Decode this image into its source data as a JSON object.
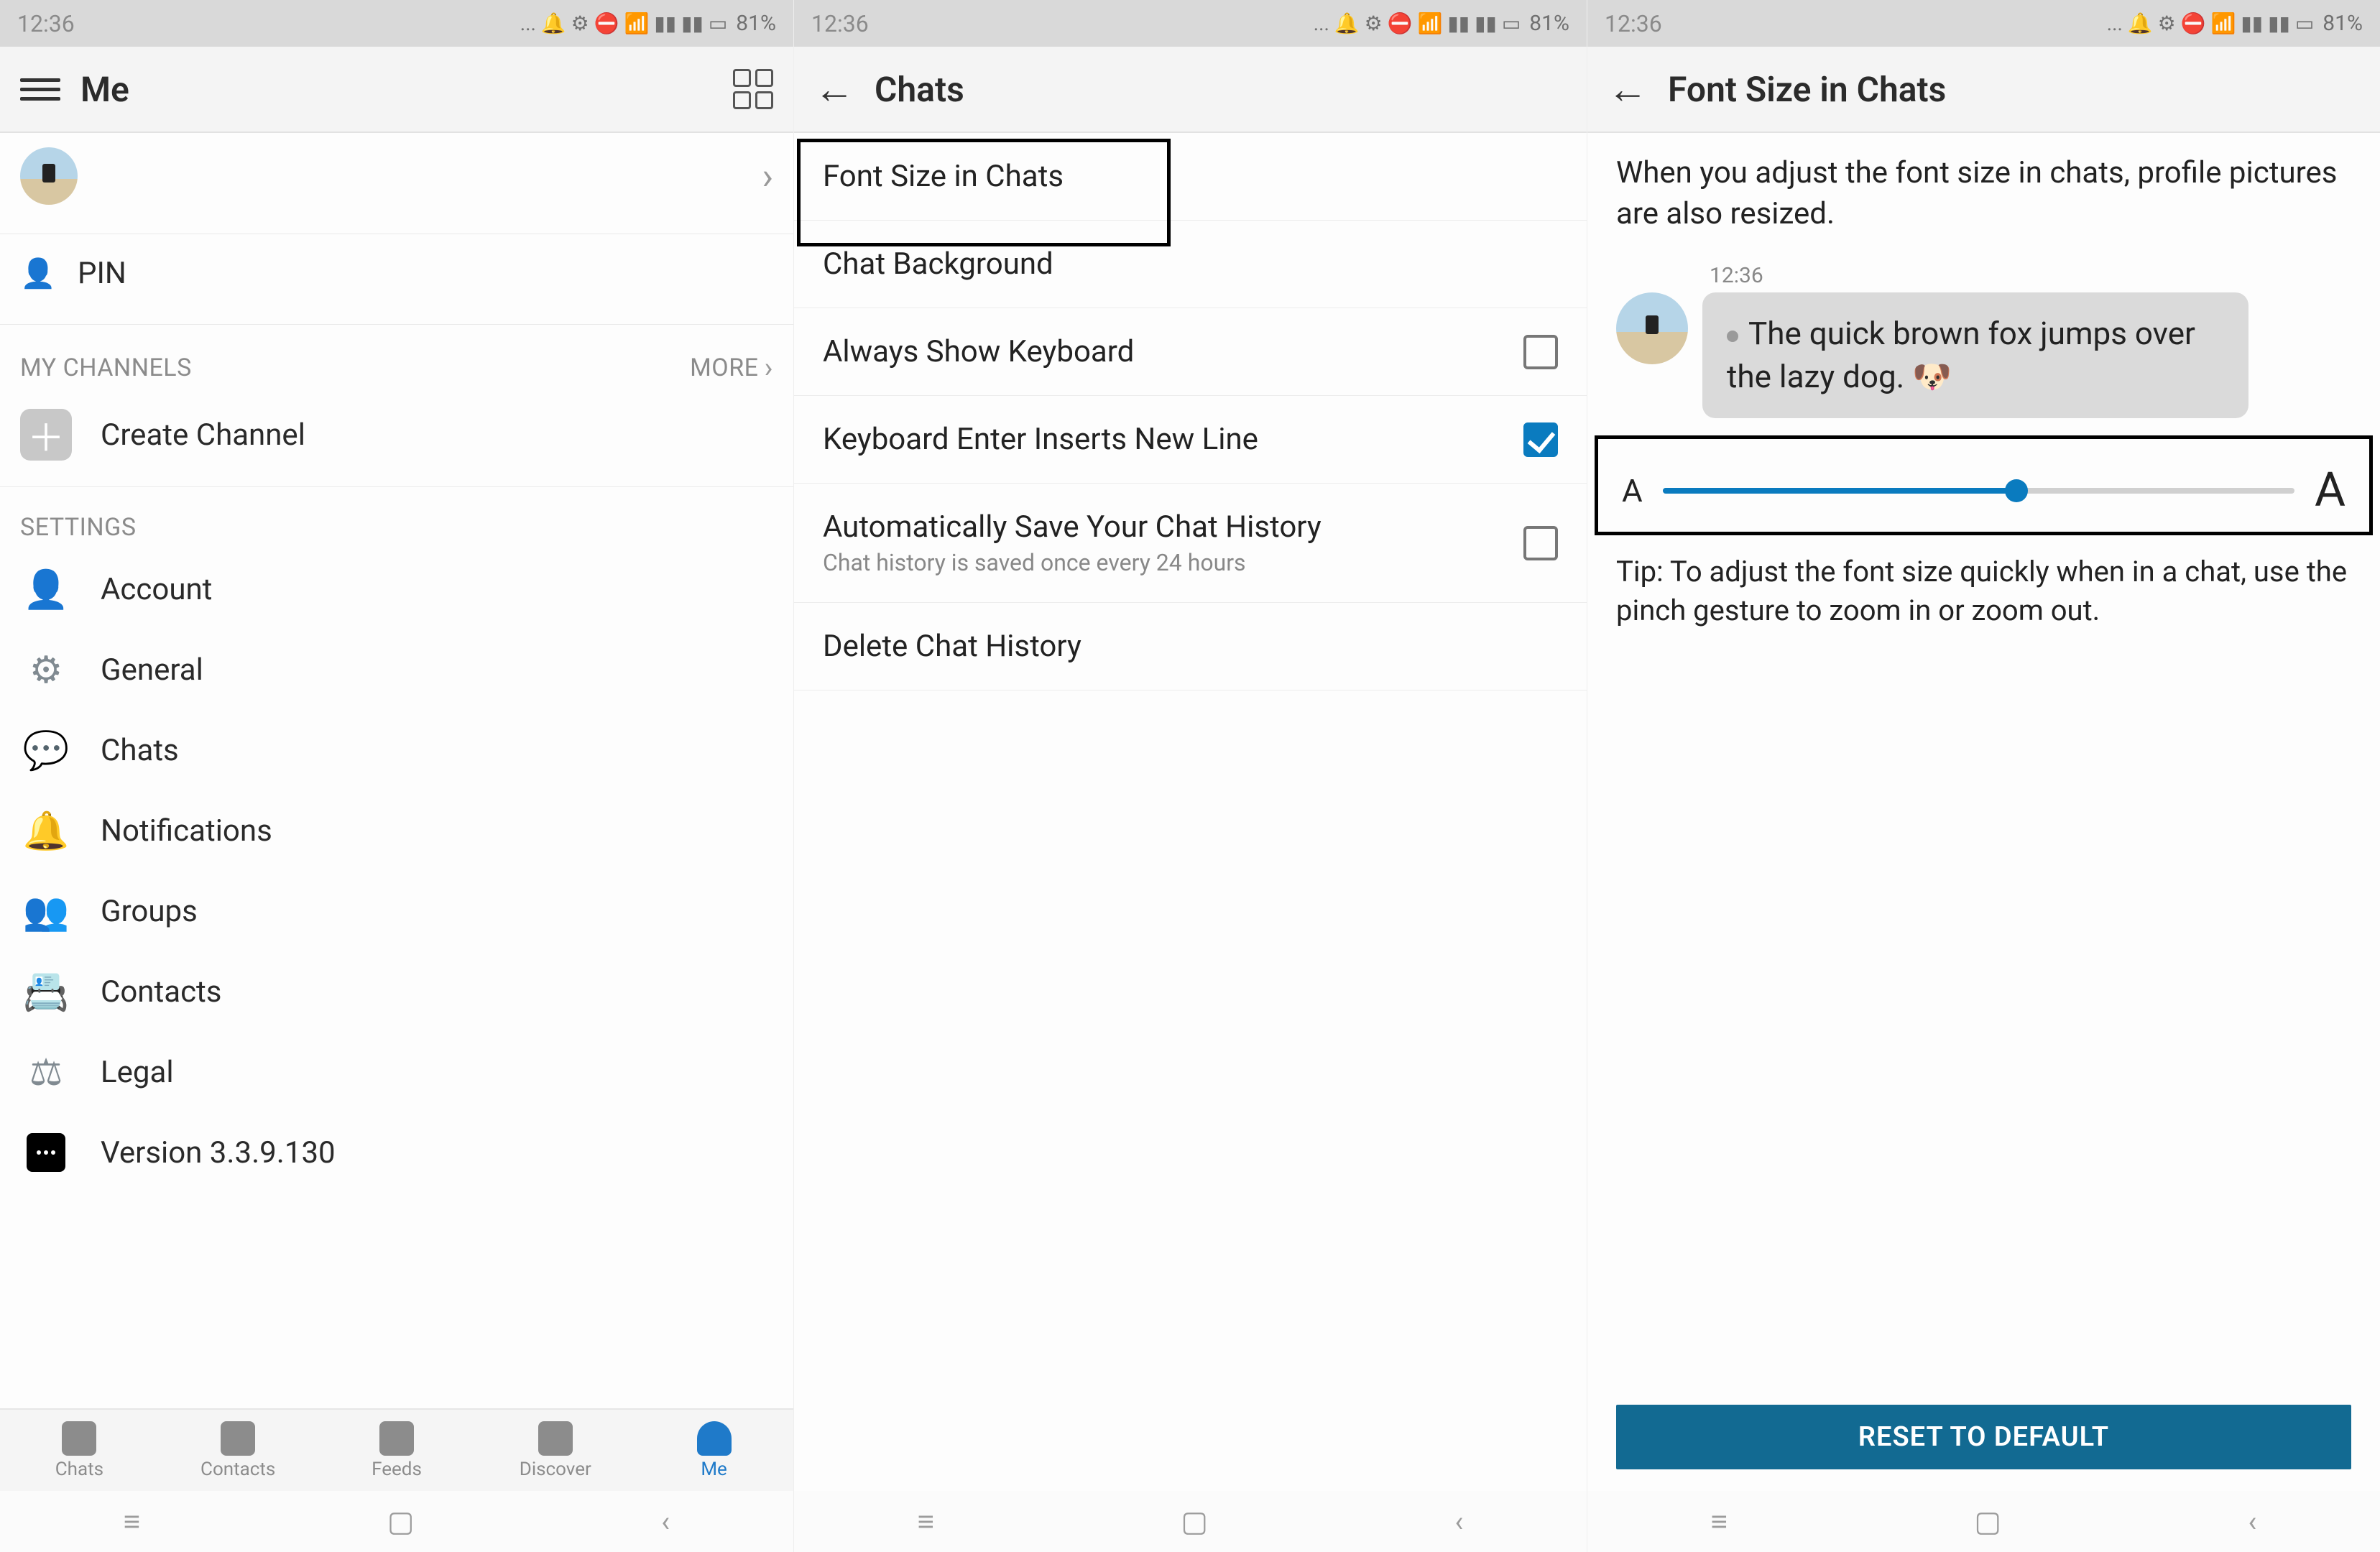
{
  "status": {
    "time": "12:36",
    "battery": "81%"
  },
  "screen1": {
    "title": "Me",
    "pin_label": "PIN",
    "sections": {
      "channels_header": "MY CHANNELS",
      "more": "MORE",
      "create_channel": "Create Channel",
      "settings_header": "SETTINGS"
    },
    "settings": [
      "Account",
      "General",
      "Chats",
      "Notifications",
      "Groups",
      "Contacts",
      "Legal",
      "Version 3.3.9.130"
    ],
    "bottom_tabs": [
      "Chats",
      "Contacts",
      "Feeds",
      "Discover",
      "Me"
    ],
    "active_tab_index": 4
  },
  "screen2": {
    "title": "Chats",
    "items": [
      {
        "label": "Font Size in Chats",
        "type": "link"
      },
      {
        "label": "Chat Background",
        "type": "link"
      },
      {
        "label": "Always Show Keyboard",
        "type": "check",
        "checked": false
      },
      {
        "label": "Keyboard Enter Inserts New Line",
        "type": "check",
        "checked": true
      },
      {
        "label": "Automatically Save Your Chat History",
        "sub": "Chat history is saved once every 24 hours",
        "type": "check",
        "checked": false
      },
      {
        "label": "Delete Chat History",
        "type": "link"
      }
    ],
    "highlight_index": 0
  },
  "screen3": {
    "title": "Font Size in Chats",
    "description": "When you adjust the font size in chats, profile pictures are also resized.",
    "preview_time": "12:36",
    "preview_text": "The quick brown fox jumps over the lazy dog. 🐶",
    "slider_percent": 56,
    "tip": "Tip: To adjust the font size quickly when in a chat, use the pinch gesture to zoom in or zoom out.",
    "reset_label": "RESET TO DEFAULT",
    "small_A": "A",
    "big_A": "A"
  }
}
